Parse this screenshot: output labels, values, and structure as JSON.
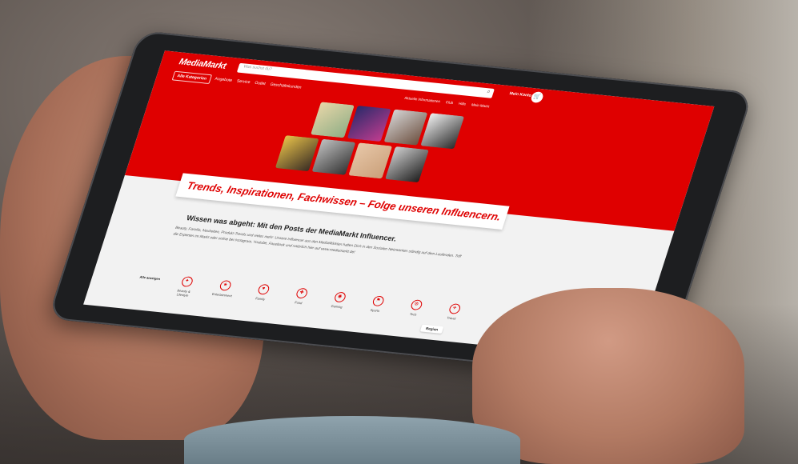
{
  "site": {
    "logo": "MediaMarkt",
    "search_placeholder": "Was suchst du?",
    "account_label": "Mein Konto",
    "all_categories": "Alle Kategorien",
    "nav": [
      "Angebote",
      "Service",
      "Outlet",
      "Geschäftskunden"
    ],
    "right_nav": [
      "Aktuelle Informationen",
      "Club",
      "Hilfe",
      "Mein Markt"
    ]
  },
  "banner": {
    "title": "Trends, Inspirationen, Fachwissen – Folge unseren Influencern."
  },
  "content": {
    "title": "Wissen was abgeht: Mit den Posts der MediaMarkt Influencer.",
    "body": "Beauty, Familie, Neuheiten, Produkt-Trends und vieles mehr: Unsere Influencer aus den MediaMärkten halten Dich in den Sozialen Netzwerken ständig auf dem Laufenden. Triff die Experten im Markt oder online bei Instagram, Youtube, Facebook und natürlich hier auf www.mediamarkt.de!"
  },
  "categories": {
    "all_label": "Alle anzeigen",
    "items": [
      {
        "label": "Beauty & Lifestyle",
        "icon": "beauty-icon",
        "glyph": "✦"
      },
      {
        "label": "Entertainment",
        "icon": "entertainment-icon",
        "glyph": "★"
      },
      {
        "label": "Family",
        "icon": "family-icon",
        "glyph": "♥"
      },
      {
        "label": "Food",
        "icon": "food-icon",
        "glyph": "✚"
      },
      {
        "label": "Gaming",
        "icon": "gaming-icon",
        "glyph": "◉"
      },
      {
        "label": "Sports",
        "icon": "sports-icon",
        "glyph": "⚑"
      },
      {
        "label": "Tech",
        "icon": "tech-icon",
        "glyph": "⚙"
      },
      {
        "label": "Travel",
        "icon": "travel-icon",
        "glyph": "✈"
      }
    ]
  },
  "pagination": {
    "next_label": "Region"
  },
  "colors": {
    "brand_red": "#df0000"
  }
}
